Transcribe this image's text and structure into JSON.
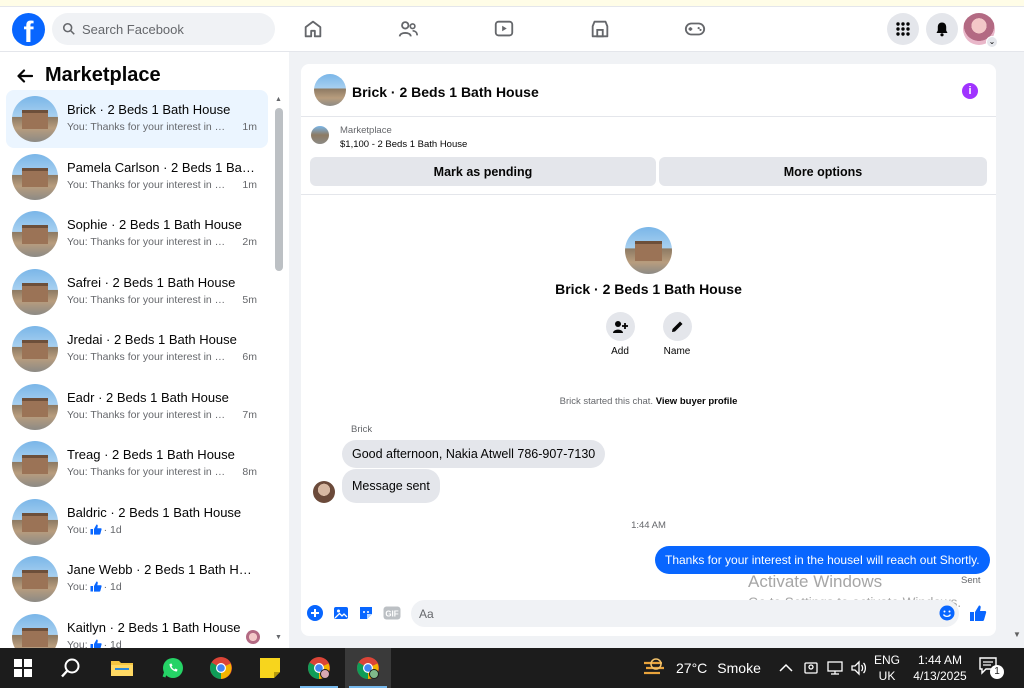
{
  "search": {
    "placeholder": "Search Facebook"
  },
  "sidebar": {
    "title": "Marketplace",
    "conversations": [
      {
        "name": "Brick · 2 Beds 1 Bath House",
        "preview": "You: Thanks for your interest in th...",
        "time": "1m",
        "active": true
      },
      {
        "name": "Pamela Carlson · 2 Beds 1 Bath ...",
        "preview": "You: Thanks for your interest in th...",
        "time": "1m"
      },
      {
        "name": "Sophie · 2 Beds 1 Bath House",
        "preview": "You: Thanks for your interest in th...",
        "time": "2m"
      },
      {
        "name": "Safrei · 2 Beds 1 Bath House",
        "preview": "You: Thanks for your interest in th...",
        "time": "5m"
      },
      {
        "name": "Jredai · 2 Beds 1 Bath House",
        "preview": "You: Thanks for your interest in th...",
        "time": "6m"
      },
      {
        "name": "Eadr · 2 Beds 1 Bath House",
        "preview": "You: Thanks for your interest in th...",
        "time": "7m"
      },
      {
        "name": "Treag · 2 Beds 1 Bath House",
        "preview": "You: Thanks for your interest in th...",
        "time": "8m"
      },
      {
        "name": "Baldric · 2 Beds 1 Bath House",
        "preview": "You:",
        "time": "· 1d",
        "like": true
      },
      {
        "name": "Jane Webb · 2 Beds 1 Bath House",
        "preview": "You:",
        "time": "· 1d",
        "like": true
      },
      {
        "name": "Kaitlyn · 2 Beds 1 Bath House",
        "preview": "You:",
        "time": "· 1d",
        "like": true
      }
    ]
  },
  "chat": {
    "title": "Brick · 2 Beds 1 Bath House",
    "listing_source": "Marketplace",
    "listing_title": "$1,100 - 2 Beds 1 Bath House",
    "mark_pending_label": "Mark as pending",
    "more_options_label": "More options",
    "profile_name": "Brick · 2 Beds 1 Bath House",
    "add_label": "Add",
    "name_label": "Name",
    "started_text": "Brick started this chat.",
    "view_profile_label": "View buyer profile",
    "sender_name": "Brick",
    "messages_in": [
      "Good afternoon, Nakia Atwell 786-907-7130",
      "Message sent"
    ],
    "timestamp": "1:44 AM",
    "message_out": "Thanks for your interest in the houseI will reach out Shortly.",
    "sent_label": "Sent",
    "composer_placeholder": "Aa"
  },
  "watermark": {
    "line1": "Activate Windows",
    "line2": "Go to Settings to activate Windows."
  },
  "taskbar": {
    "temperature": "27°C",
    "weather": "Smoke",
    "lang1": "ENG",
    "lang2": "UK",
    "time": "1:44 AM",
    "date": "4/13/2025",
    "notif_count": "1"
  },
  "colors": {
    "brand": "#0866ff",
    "info": "#a033ff",
    "active_row": "#ebf5ff"
  }
}
